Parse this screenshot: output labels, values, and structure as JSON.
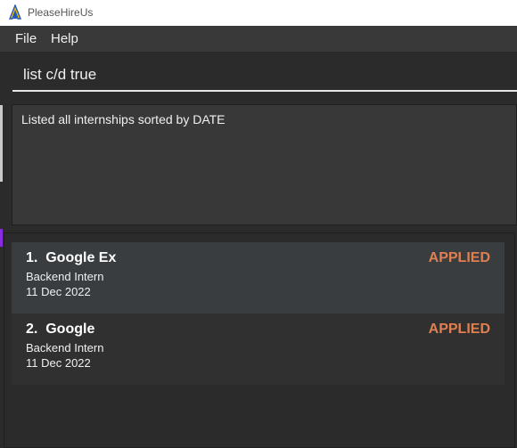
{
  "window": {
    "title": "PleaseHireUs"
  },
  "menu": {
    "items": [
      "File",
      "Help"
    ]
  },
  "command": {
    "value": "list c/d true"
  },
  "result": {
    "message": "Listed all internships sorted by DATE"
  },
  "internships": [
    {
      "index": "1.",
      "company": "Google Ex",
      "role": "Backend Intern",
      "date": "11 Dec 2022",
      "status": "APPLIED"
    },
    {
      "index": "2.",
      "company": "Google",
      "role": "Backend Intern",
      "date": "11 Dec 2022",
      "status": "APPLIED"
    }
  ],
  "colors": {
    "status_applied": "#e07f4f",
    "app_icon_yellow": "#f2c200",
    "app_icon_blue": "#2457b8"
  },
  "icons": {
    "app": "please-hire-us-logo-icon"
  }
}
